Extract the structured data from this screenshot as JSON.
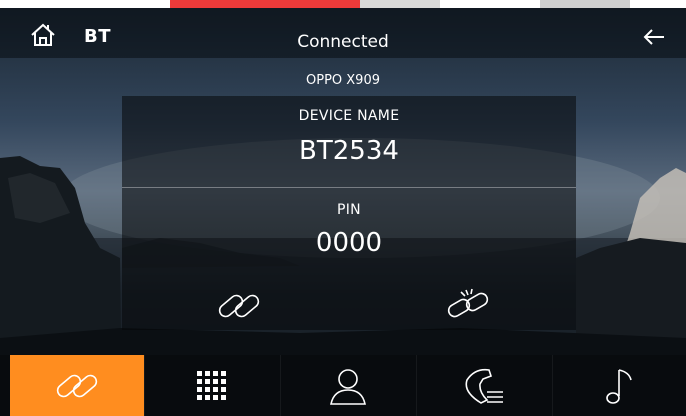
{
  "header": {
    "title": "BT",
    "status": "Connected"
  },
  "connected_device": "OPPO X909",
  "panel": {
    "device_name_label": "DEVICE NAME",
    "device_name_value": "BT2534",
    "pin_label": "PIN",
    "pin_value": "0000"
  },
  "icons": {
    "home": "home-icon",
    "back": "arrow-left-icon",
    "connect": "link-icon",
    "disconnect": "unlink-icon"
  },
  "bottom_nav": [
    {
      "icon": "link-icon",
      "active": true
    },
    {
      "icon": "dialpad-icon",
      "active": false
    },
    {
      "icon": "contacts-icon",
      "active": false
    },
    {
      "icon": "call-log-icon",
      "active": false
    },
    {
      "icon": "music-icon",
      "active": false
    }
  ],
  "colors": {
    "accent": "#ff8d1f",
    "text": "#ffffff"
  }
}
